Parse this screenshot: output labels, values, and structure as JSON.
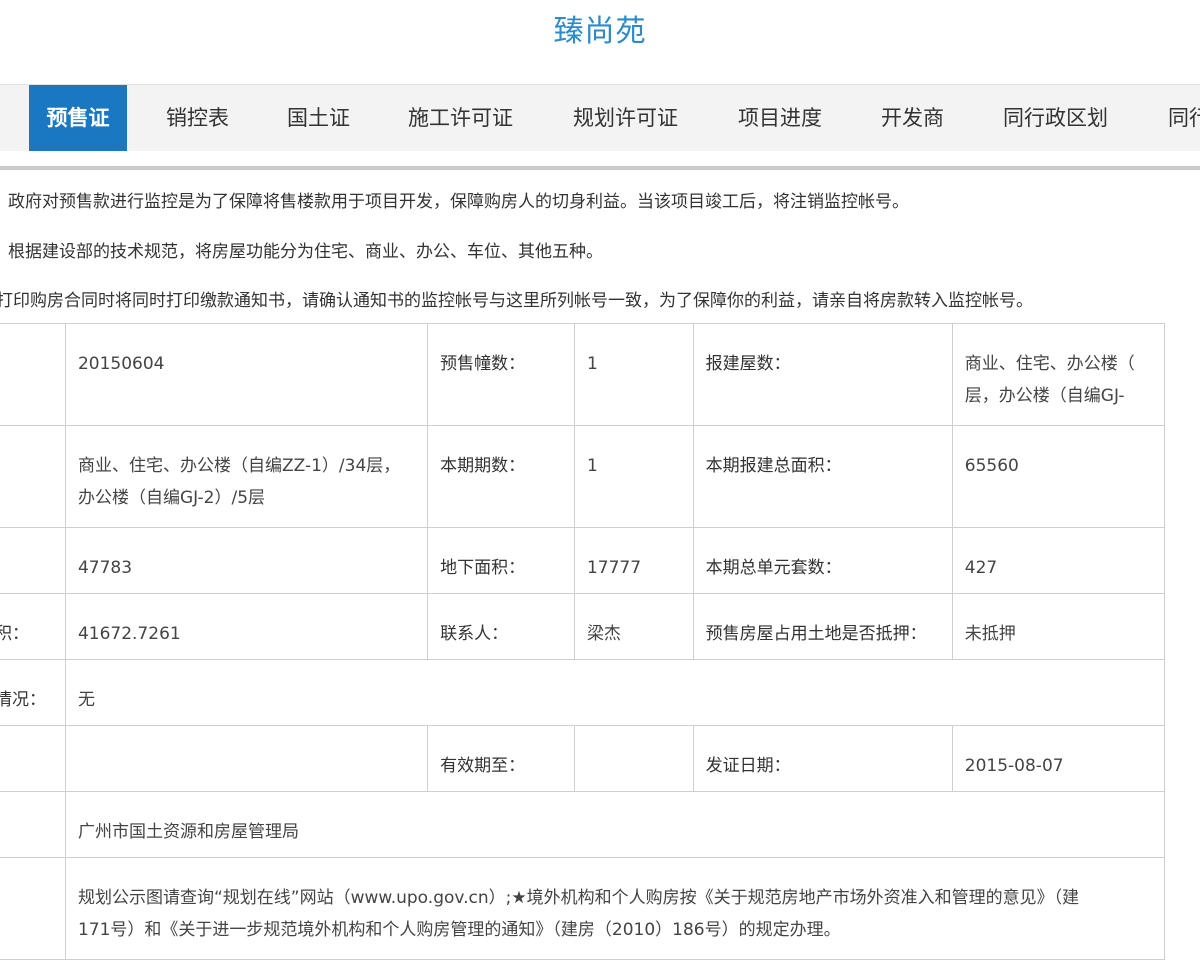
{
  "page_title": "臻尚苑",
  "tabs": [
    {
      "label": "预售证",
      "active": true
    },
    {
      "label": "销控表",
      "active": false
    },
    {
      "label": "国土证",
      "active": false
    },
    {
      "label": "施工许可证",
      "active": false
    },
    {
      "label": "规划许可证",
      "active": false
    },
    {
      "label": "项目进度",
      "active": false
    },
    {
      "label": "开发商",
      "active": false
    },
    {
      "label": "同行政区划",
      "active": false
    },
    {
      "label": "同行",
      "active": false
    }
  ],
  "notices": [
    "政府对预售款进行监控是为了保障将售楼款用于项目开发，保障购房人的切身利益。当该项目竣工后，将注销监控帐号。",
    "根据建设部的技术规范，将房屋功能分为住宅、商业、办公、车位、其他五种。",
    "打印购房合同时将同时打印缴款通知书，请确认通知书的监控帐号与这里所列帐号一致，为了保障你的利益，请亲自将房款转入监控帐号。"
  ],
  "table": {
    "r1": {
      "c2": "20150604",
      "c3": "预售幢数：",
      "c4": "1",
      "c5": "报建屋数：",
      "c6_line1": "商业、住宅、办公楼（",
      "c6_line2": "层，办公楼（自编GJ-"
    },
    "r2": {
      "c2_line1": "商业、住宅、办公楼（自编ZZ-1）/34层，",
      "c2_line2": "办公楼（自编GJ-2）/5层",
      "c3": "本期期数：",
      "c4": "1",
      "c5": "本期报建总面积：",
      "c6": "65560"
    },
    "r3": {
      "c2": "47783",
      "c3": "地下面积：",
      "c4": "17777",
      "c5": "本期总单元套数：",
      "c6": "427"
    },
    "r4": {
      "c1": "面积：",
      "c2": "41672.7261",
      "c3": "联系人：",
      "c4": "梁杰",
      "c5": "预售房屋占用土地是否抵押：",
      "c6": "未抵押"
    },
    "r5": {
      "c1": "积情况：",
      "c2": "无"
    },
    "r6": {
      "c3": "有效期至：",
      "c5": "发证日期：",
      "c6": "2015-08-07"
    },
    "r7": {
      "c2": "广州市国土资源和房屋管理局"
    },
    "r8": {
      "c2_line1": "规划公示图请查询“规划在线”网站（www.upo.gov.cn）;★境外机构和个人购房按《关于规范房地产市场外资准入和管理的意见》（建",
      "c2_line2": "171号）和《关于进一步规范境外机构和个人购房管理的通知》（建房（2010）186号）的规定办理。"
    }
  }
}
